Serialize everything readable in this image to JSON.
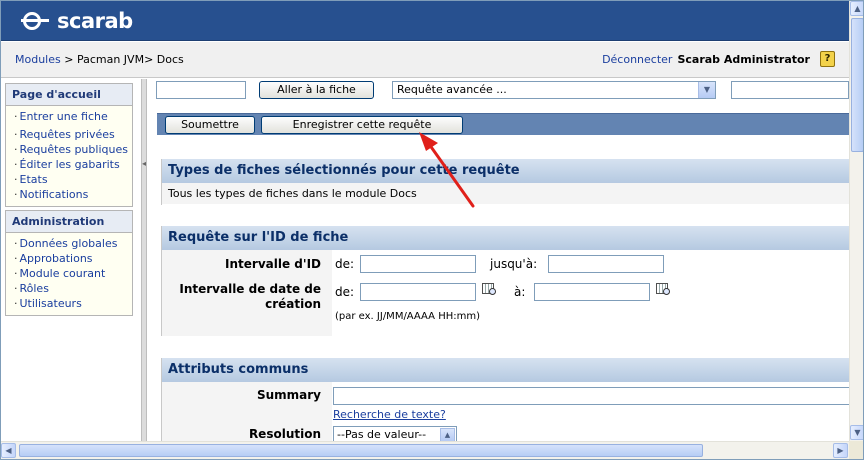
{
  "header": {
    "logo_text": "scarab"
  },
  "breadcrumb": {
    "modules": "Modules",
    "sep1": " > ",
    "rest": "Pacman JVM> Docs"
  },
  "user": {
    "logout": "Déconnecter",
    "name": "Scarab Administrator",
    "help_glyph": "?"
  },
  "sidebar": {
    "home_title": "Page d'accueil",
    "home_items": [
      "Entrer une fiche",
      "Requêtes privées",
      "Requêtes publiques",
      "Éditer les gabarits",
      "Etats",
      "Notifications"
    ],
    "admin_title": "Administration",
    "admin_items": [
      "Données globales",
      "Approbations",
      "Module courant",
      "Rôles",
      "Utilisateurs"
    ]
  },
  "toolbar": {
    "goto_button": "Aller à la fiche",
    "query_select": "Requête avancée ..."
  },
  "actions": {
    "submit_button": "Soumettre",
    "save_query_button": "Enregistrer cette requête"
  },
  "sections": {
    "types_title": "Types de fiches sélectionnés pour cette requête",
    "types_body": "Tous les types de fiches dans le module Docs",
    "id_title": "Requête sur l'ID de fiche",
    "id_range_label": "Intervalle d'ID",
    "from": "de:",
    "to": "jusqu'à:",
    "date_range_label_1": "Intervalle de date de",
    "date_range_label_2": "création",
    "date_to": "à:",
    "date_hint": "(par ex. JJ/MM/AAAA HH:mm)",
    "common_title": "Attributs communs",
    "summary_label": "Summary",
    "text_search_link": "Recherche de texte?",
    "resolution_label": "Resolution",
    "resolution_value": "--Pas de valeur--"
  },
  "colors": {
    "header_bg": "#27508f",
    "action_bar": "#6384b2",
    "annotation_arrow": "#e0201a"
  }
}
